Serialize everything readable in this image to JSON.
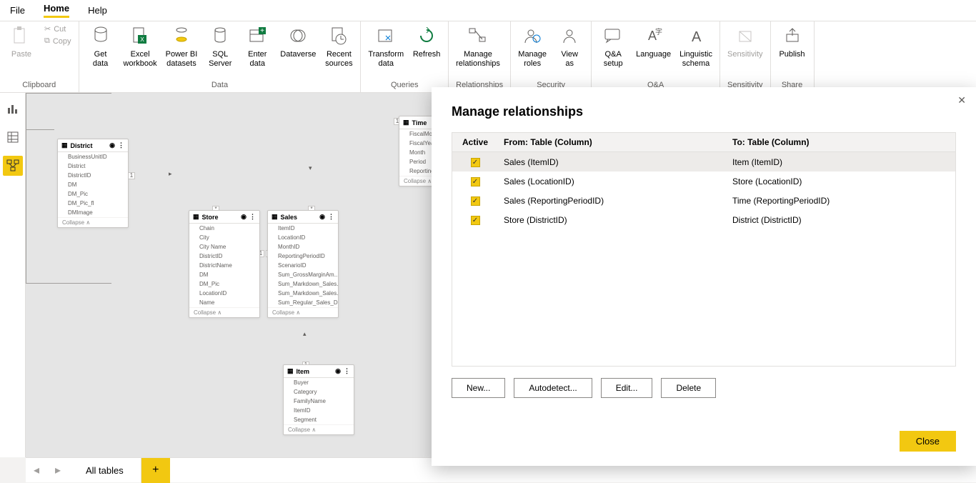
{
  "menu": {
    "file": "File",
    "home": "Home",
    "help": "Help"
  },
  "ribbon": {
    "clipboard": {
      "label": "Clipboard",
      "paste": "Paste",
      "cut": "Cut",
      "copy": "Copy"
    },
    "data": {
      "label": "Data",
      "getdata": "Get\ndata",
      "excel": "Excel\nworkbook",
      "pbi": "Power BI\ndatasets",
      "sql": "SQL\nServer",
      "enter": "Enter\ndata",
      "dataverse": "Dataverse",
      "recent": "Recent\nsources"
    },
    "queries": {
      "label": "Queries",
      "transform": "Transform\ndata",
      "refresh": "Refresh"
    },
    "relationships": {
      "label": "Relationships",
      "manage": "Manage\nrelationships"
    },
    "security": {
      "label": "Security",
      "roles": "Manage\nroles",
      "viewas": "View\nas"
    },
    "qa": {
      "label": "Q&A",
      "setup": "Q&A\nsetup",
      "lang": "Language\n",
      "schema": "Linguistic\nschema"
    },
    "sensitivity": {
      "label": "Sensitivity",
      "btn": "Sensitivity\n"
    },
    "share": {
      "label": "Share",
      "publish": "Publish"
    }
  },
  "tables": {
    "district": {
      "name": "District",
      "fields": [
        "BusinessUnitID",
        "District",
        "DistrictID",
        "DM",
        "DM_Pic",
        "DM_Pic_fl",
        "DMImage"
      ],
      "collapse": "Collapse"
    },
    "store": {
      "name": "Store",
      "fields": [
        "Chain",
        "City",
        "City Name",
        "DistrictID",
        "DistrictName",
        "DM",
        "DM_Pic",
        "LocationID",
        "Name"
      ],
      "collapse": "Collapse"
    },
    "sales": {
      "name": "Sales",
      "fields": [
        "ItemID",
        "LocationID",
        "MonthID",
        "ReportingPeriodID",
        "ScenarioID",
        "Sum_GrossMarginAm...",
        "Sum_Markdown_Sales...",
        "Sum_Markdown_Sales...",
        "Sum_Regular_Sales_D..."
      ],
      "collapse": "Collapse"
    },
    "time": {
      "name": "Time",
      "fields": [
        "FiscalMonth",
        "FiscalYear",
        "Month",
        "Period",
        "ReportingPer..."
      ],
      "collapse": "Collapse"
    },
    "item": {
      "name": "Item",
      "fields": [
        "Buyer",
        "Category",
        "FamilyName",
        "ItemID",
        "Segment"
      ],
      "collapse": "Collapse"
    }
  },
  "bottom": {
    "tab": "All tables"
  },
  "dialog": {
    "title": "Manage relationships",
    "head_active": "Active",
    "head_from": "From: Table (Column)",
    "head_to": "To: Table (Column)",
    "rows": [
      {
        "from": "Sales (ItemID)",
        "to": "Item (ItemID)"
      },
      {
        "from": "Sales (LocationID)",
        "to": "Store (LocationID)"
      },
      {
        "from": "Sales (ReportingPeriodID)",
        "to": "Time (ReportingPeriodID)"
      },
      {
        "from": "Store (DistrictID)",
        "to": "District (DistrictID)"
      }
    ],
    "new": "New...",
    "auto": "Autodetect...",
    "edit": "Edit...",
    "del": "Delete",
    "close": "Close"
  },
  "conn_one": "1",
  "conn_many": "*"
}
